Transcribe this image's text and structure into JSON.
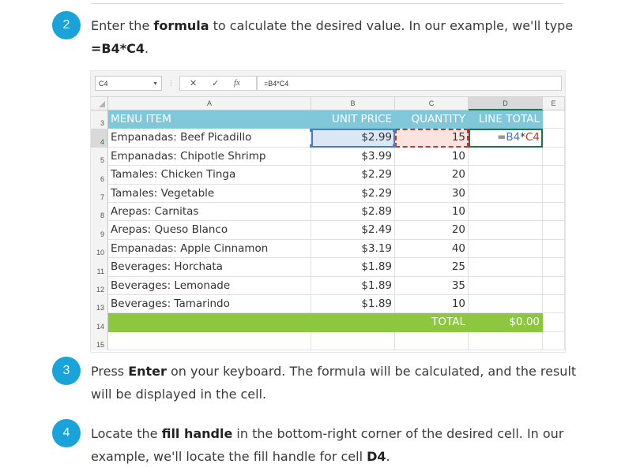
{
  "steps": [
    {
      "number": "2",
      "parts": [
        {
          "t": "Enter the ",
          "b": false
        },
        {
          "t": "formula",
          "b": true
        },
        {
          "t": " to calculate the desired value. In our example, we'll type ",
          "b": false
        },
        {
          "t": "=B4*C4",
          "b": true
        },
        {
          "t": ".",
          "b": false
        }
      ]
    },
    {
      "number": "3",
      "parts": [
        {
          "t": "Press ",
          "b": false
        },
        {
          "t": "Enter",
          "b": true
        },
        {
          "t": " on your keyboard. The formula will be calculated, and the result will be displayed in the cell.",
          "b": false
        }
      ]
    },
    {
      "number": "4",
      "parts": [
        {
          "t": "Locate the ",
          "b": false
        },
        {
          "t": "fill handle",
          "b": true
        },
        {
          "t": " in the bottom-right corner of the desired cell. In our example, we'll locate the fill handle for cell ",
          "b": false
        },
        {
          "t": "D4",
          "b": true
        },
        {
          "t": ".",
          "b": false
        }
      ]
    }
  ],
  "sheet": {
    "name_box": "C4",
    "formula": "=B4*C4",
    "fx_label": "fx",
    "cancel_glyph": "✕",
    "enter_glyph": "✓",
    "columns": [
      "A",
      "B",
      "C",
      "D",
      "E"
    ],
    "selected_column": "D",
    "header_row": {
      "row": "3",
      "a": "MENU ITEM",
      "b": "UNIT PRICE",
      "c": "QUANTITY",
      "d": "LINE TOTAL"
    },
    "rows": [
      {
        "row": "4",
        "a": "Empanadas: Beef Picadillo",
        "b": "$2.99",
        "c": "15",
        "d": "=B4*C4"
      },
      {
        "row": "5",
        "a": "Empanadas: Chipotle Shrimp",
        "b": "$3.99",
        "c": "10",
        "d": ""
      },
      {
        "row": "6",
        "a": "Tamales: Chicken Tinga",
        "b": "$2.29",
        "c": "20",
        "d": ""
      },
      {
        "row": "7",
        "a": "Tamales: Vegetable",
        "b": "$2.29",
        "c": "30",
        "d": ""
      },
      {
        "row": "8",
        "a": "Arepas: Carnitas",
        "b": "$2.89",
        "c": "10",
        "d": ""
      },
      {
        "row": "9",
        "a": "Arepas: Queso Blanco",
        "b": "$2.49",
        "c": "20",
        "d": ""
      },
      {
        "row": "10",
        "a": "Empanadas: Apple Cinnamon",
        "b": "$3.19",
        "c": "40",
        "d": ""
      },
      {
        "row": "11",
        "a": "Beverages: Horchata",
        "b": "$1.89",
        "c": "25",
        "d": ""
      },
      {
        "row": "12",
        "a": "Beverages: Lemonade",
        "b": "$1.89",
        "c": "35",
        "d": ""
      },
      {
        "row": "13",
        "a": "Beverages: Tamarindo",
        "b": "$1.89",
        "c": "10",
        "d": ""
      }
    ],
    "total_row": {
      "row": "14",
      "label": "TOTAL",
      "value": "$0.00"
    },
    "empty_row": {
      "row": "15"
    },
    "formula_parts": {
      "eq": "=",
      "ref1": "B4",
      "op": "*",
      "ref2": "C4"
    },
    "colors": {
      "header_fill": "#7fc7d9",
      "total_fill": "#8dc63f",
      "step_circle": "#1aa3d9",
      "ref_b": "#4472c4",
      "ref_c": "#c0392b"
    }
  }
}
